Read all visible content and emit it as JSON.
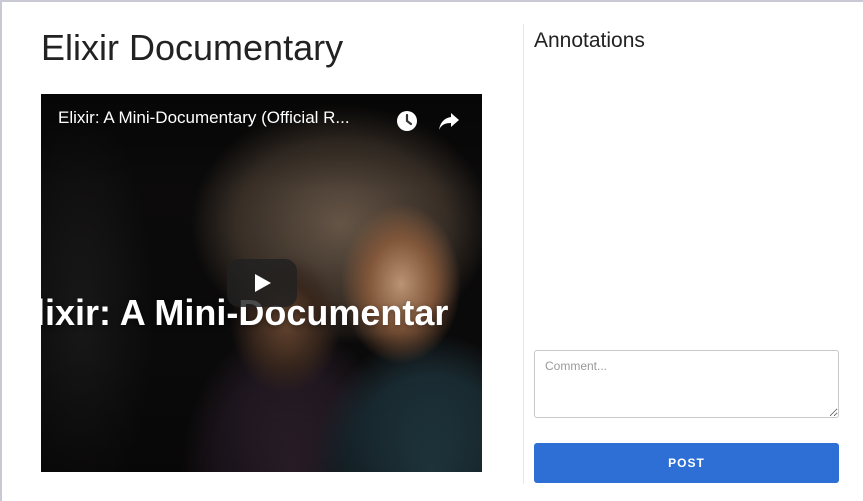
{
  "page": {
    "title": "Elixir Documentary"
  },
  "video": {
    "title": "Elixir: A Mini-Documentary (Official R...",
    "overlay_text": "lixir: A Mini-Documentar",
    "icons": [
      "clock-icon",
      "share-arrow-icon",
      "play-icon"
    ]
  },
  "annotations": {
    "heading": "Annotations",
    "comment_placeholder": "Comment...",
    "comment_value": "",
    "post_label": "POST"
  },
  "colors": {
    "accent": "#2e6fd6",
    "frame_border": "#c9c9d6"
  }
}
